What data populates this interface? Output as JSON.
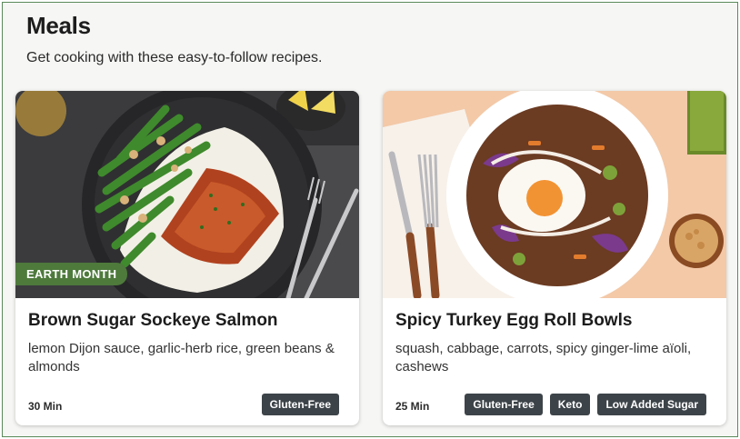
{
  "page": {
    "title": "Meals",
    "subtitle": "Get cooking with these easy-to-follow recipes."
  },
  "meals": [
    {
      "badge": "EARTH MONTH",
      "title": "Brown Sugar Sockeye Salmon",
      "description": "lemon Dijon sauce, garlic-herb rice, green beans & almonds",
      "time": "30 Min",
      "tags": [
        "Gluten-Free"
      ]
    },
    {
      "title": "Spicy Turkey Egg Roll Bowls",
      "description": "squash, cabbage, carrots, spicy ginger-lime aïoli, cashews",
      "time": "25 Min",
      "tags": [
        "Gluten-Free",
        "Keto",
        "Low Added Sugar"
      ]
    }
  ],
  "colors": {
    "badge_green": "#4e7a3c",
    "tag_dark": "#3d4449",
    "frame_border": "#5a8a5a"
  }
}
